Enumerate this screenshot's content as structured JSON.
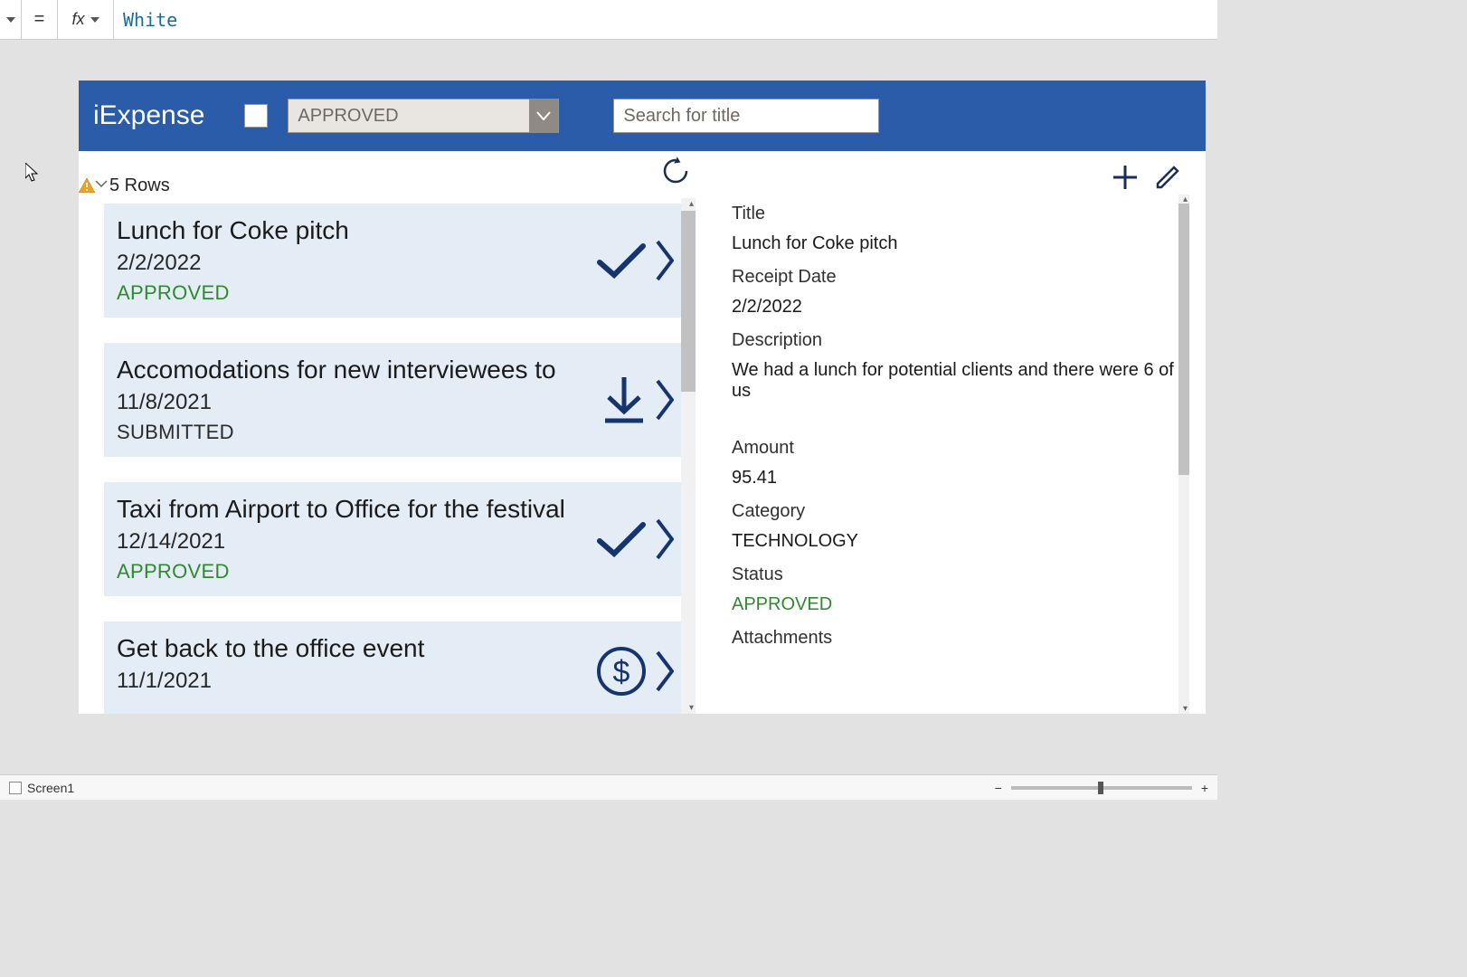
{
  "formula_bar": {
    "equals": "=",
    "fx": "fx",
    "value": "White"
  },
  "app": {
    "title": "iExpense",
    "filter_selected": "APPROVED",
    "search_placeholder": "Search for title"
  },
  "left": {
    "rows_label": "5 Rows"
  },
  "items": [
    {
      "title": "Lunch for Coke pitch",
      "date": "2/2/2022",
      "status": "APPROVED",
      "status_class": "approved",
      "icon": "check"
    },
    {
      "title": "Accomodations for new interviewees to",
      "date": "11/8/2021",
      "status": "SUBMITTED",
      "status_class": "submitted",
      "icon": "download"
    },
    {
      "title": "Taxi from Airport to Office for the festival",
      "date": "12/14/2021",
      "status": "APPROVED",
      "status_class": "approved",
      "icon": "check"
    },
    {
      "title": "Get back to the office event",
      "date": "11/1/2021",
      "status": "",
      "status_class": "",
      "icon": "dollar"
    }
  ],
  "detail": {
    "labels": {
      "title": "Title",
      "receipt_date": "Receipt Date",
      "description": "Description",
      "amount": "Amount",
      "category": "Category",
      "status": "Status",
      "attachments": "Attachments"
    },
    "values": {
      "title": "Lunch for Coke pitch",
      "receipt_date": "2/2/2022",
      "description": "We had a lunch for potential clients and there were 6 of us",
      "amount": "95.41",
      "category": "TECHNOLOGY",
      "status": "APPROVED"
    }
  },
  "status_bar": {
    "screen": "Screen1",
    "minus": "−",
    "plus": "+"
  }
}
